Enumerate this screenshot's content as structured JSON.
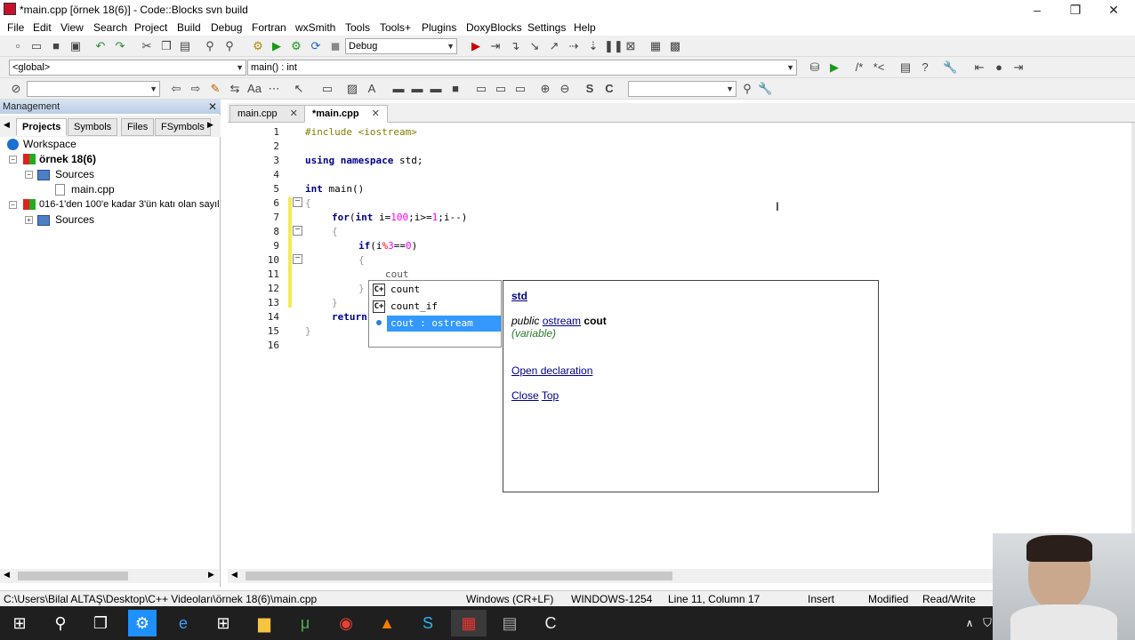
{
  "window": {
    "title": "*main.cpp [örnek 18(6)] - Code::Blocks svn build",
    "minimize": "–",
    "maximize": "❐",
    "close": "✕"
  },
  "menu": [
    "File",
    "Edit",
    "View",
    "Search",
    "Project",
    "Build",
    "Debug",
    "Fortran",
    "wxSmith",
    "Tools",
    "Tools+",
    "Plugins",
    "DoxyBlocks",
    "Settings",
    "Help"
  ],
  "toolbar": {
    "build_target": "Debug",
    "scope": "<global>",
    "function": "main() : int",
    "search_value": "",
    "replace_value": ""
  },
  "management": {
    "header": "Management",
    "close": "✕",
    "tabs": [
      "Projects",
      "Symbols",
      "Files",
      "FSymbols"
    ],
    "tree": {
      "workspace": "Workspace",
      "project1": "örnek 18(6)",
      "project1_sources": "Sources",
      "project1_file": "main.cpp",
      "project2": "016-1'den 100'e kadar 3'ün katı olan sayıl",
      "project2_sources": "Sources"
    }
  },
  "editor_tabs": [
    {
      "label": "main.cpp",
      "close": "✕"
    },
    {
      "label": "*main.cpp",
      "close": "✕"
    }
  ],
  "line_numbers": [
    "1",
    "2",
    "3",
    "4",
    "5",
    "6",
    "7",
    "8",
    "9",
    "10",
    "11",
    "12",
    "13",
    "14",
    "15",
    "16"
  ],
  "code": {
    "l1_directive": "#include",
    "l1_header": " <iostream>",
    "l3_kw1": "using",
    "l3_kw2": " namespace",
    "l3_rest": " std;",
    "l5_kw": "int",
    "l5_rest": " main()",
    "l6": "{",
    "l7_kw1": "for",
    "l7_a": "(",
    "l7_kw2": "int",
    "l7_b": " i=",
    "l7_n1": "100",
    "l7_c": ";i>=",
    "l7_n2": "1",
    "l7_d": ";i--)",
    "l8": "{",
    "l9_kw": "if",
    "l9_a": "(i",
    "l9_op": "%",
    "l9_n1": "3",
    "l9_b": "==",
    "l9_n2": "0",
    "l9_c": ")",
    "l10": "{",
    "l11": "cout",
    "l12": "}",
    "l13": "}",
    "l14_kw": "return",
    "l15": "}"
  },
  "autocomplete": {
    "items": [
      {
        "icon": "C+",
        "label": "count"
      },
      {
        "icon": "C+",
        "label": "count_if"
      },
      {
        "icon": "",
        "label": "cout : ostream"
      }
    ]
  },
  "doc_popup": {
    "namespace": "std",
    "access": "public",
    "type": "ostream",
    "name": "cout",
    "kind": "(variable)",
    "open_declaration": "Open declaration",
    "close": "Close",
    "top": "Top"
  },
  "status": {
    "path": "C:\\Users\\Bilal ALTAŞ\\Desktop\\C++ Videoları\\örnek 18(6)\\main.cpp",
    "eol": "Windows (CR+LF)",
    "encoding": "WINDOWS-1254",
    "position": "Line 11, Column 17",
    "mode": "Insert",
    "modified": "Modified",
    "access": "Read/Write"
  },
  "colors": {
    "selection": "#3399ff",
    "keyword": "#00008b",
    "number": "#ff00ff",
    "taskbar": "#1f1f1f"
  }
}
